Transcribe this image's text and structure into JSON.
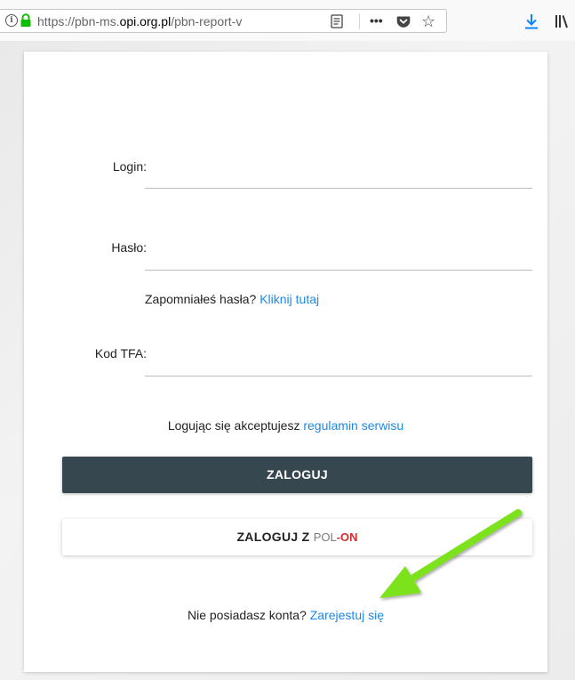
{
  "browser": {
    "url_prefix": "https://pbn-ms.",
    "url_host": "opi.org.pl",
    "url_suffix": "/pbn-report-v",
    "icons": [
      "info-icon",
      "lock-icon",
      "reader-view-icon",
      "more-dots-icon",
      "pocket-icon",
      "bookmark-star-icon",
      "download-icon",
      "library-icon"
    ]
  },
  "login_form": {
    "login_label": "Login:",
    "login_value": "",
    "password_label": "Hasło:",
    "password_value": "",
    "forgot_text": "Zapomniałeś hasła?",
    "forgot_link": "Kliknij tutaj",
    "tfa_label": "Kod TFA:",
    "tfa_value": "",
    "terms_text": "Logując się akceptujesz",
    "terms_link": "regulamin serwisu",
    "login_button": "ZALOGUJ",
    "polon_button_prefix": "ZALOGUJ Z",
    "polon_logo_pol": "POL",
    "polon_logo_on": "ON",
    "register_text": "Nie posiadasz konta?",
    "register_link": "Zarejestuj się"
  },
  "colors": {
    "login_button_bg": "#37474f",
    "link": "#1e88e5",
    "polon_red": "#d32f2f",
    "annotation_arrow": "#7be21c"
  }
}
